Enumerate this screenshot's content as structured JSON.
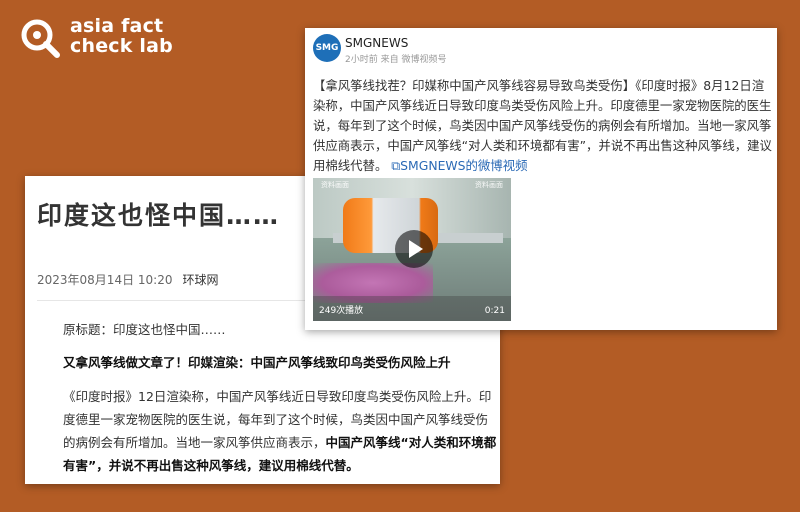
{
  "logo": {
    "line1": "asia fact",
    "line2": "check lab"
  },
  "article": {
    "title": "印度这也怪中国……",
    "date": "2023年08月14日 10:20",
    "source": "环球网",
    "original_title": "原标题：印度这也怪中国……",
    "subtitle": "又拿风筝线做文章了！印媒渲染：中国产风筝线致印鸟类受伤风险上升",
    "body_plain": "《印度时报》12日渲染称，中国产风筝线近日导致印度鸟类受伤风险上升。印度德里一家宠物医院的医生说，每年到了这个时候，鸟类因中国产风筝线受伤的病例会有所增加。当地一家风筝供应商表示，",
    "body_bold": "中国产风筝线“对人类和环境都有害”，并说不再出售这种风筝线，建议用棉线代替。"
  },
  "weibo": {
    "avatar": "SMG",
    "name": "SMGNEWS",
    "time": "2小时前 来自 微博视频号",
    "text": "【拿风筝线找茬？印媒称中国产风筝线容易导致鸟类受伤】《印度时报》8月12日渲染称，中国产风筝线近日导致印度鸟类受伤风险上升。印度德里一家宠物医院的医生说，每年到了这个时候，鸟类因中国产风筝线受伤的病例会有所增加。当地一家风筝供应商表示，中国产风筝线“对人类和环境都有害”，并说不再出售这种风筝线，建议用棉线代替。",
    "link": "SMGNEWS的微博视频",
    "video": {
      "views": "249次播放",
      "duration": "0:21",
      "caption_left": "资料画面",
      "caption_right": "资料画面"
    }
  },
  "colors": {
    "background": "#b35c25",
    "link": "#2a69b5"
  }
}
